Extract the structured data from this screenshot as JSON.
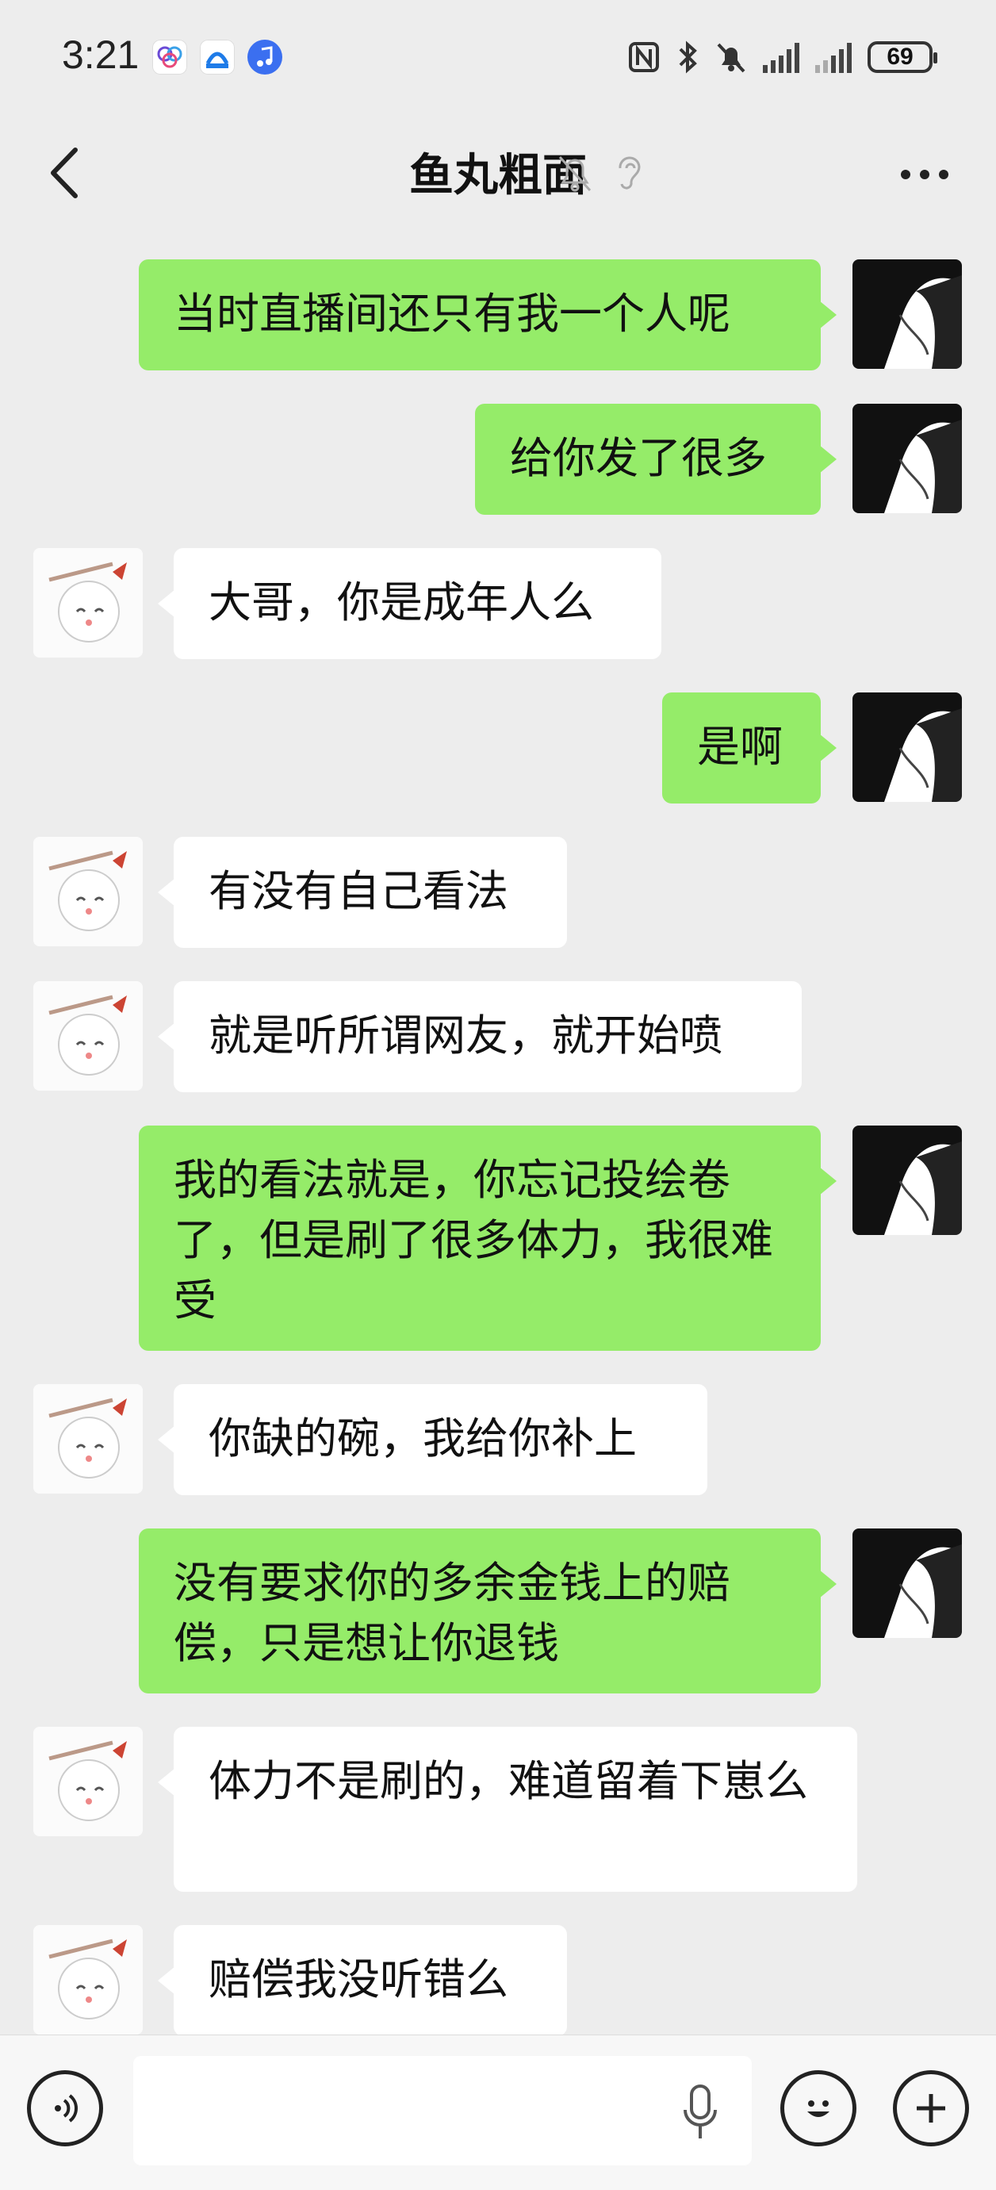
{
  "status_bar": {
    "time": "3:21",
    "battery": "69",
    "icons": [
      "nfc-icon",
      "bluetooth-icon",
      "mute-icon",
      "signal-icon",
      "signal-icon"
    ]
  },
  "header": {
    "title": "鱼丸粗面",
    "icons": [
      "chevron-left-icon",
      "bell-muted-icon",
      "ear-icon",
      "more-icon"
    ]
  },
  "colors": {
    "sent_bubble": "#95ec69",
    "received_bubble": "#ffffff",
    "background": "#ededed"
  },
  "messages": [
    {
      "side": "right",
      "text": "当时直播间还只有我一个人呢"
    },
    {
      "side": "right",
      "text": "给你发了很多"
    },
    {
      "side": "left",
      "text": "大哥，你是成年人么"
    },
    {
      "side": "right",
      "text": "是啊"
    },
    {
      "side": "left",
      "text": "有没有自己看法"
    },
    {
      "side": "left",
      "text": "就是听所谓网友，就开始喷"
    },
    {
      "side": "right",
      "text": "我的看法就是，你忘记投绘卷了，但是刷了很多体力，我很难受"
    },
    {
      "side": "left",
      "text": "你缺的碗，我给你补上"
    },
    {
      "side": "right",
      "text": "没有要求你的多余金钱上的赔偿，只是想让你退钱"
    },
    {
      "side": "left",
      "text": "体力不是刷的，难道留着下崽么"
    },
    {
      "side": "left",
      "text": "赔偿我没听错么"
    }
  ],
  "input_bar": {
    "placeholder": "",
    "icons": [
      "voice-icon",
      "microphone-icon",
      "emoji-icon",
      "plus-icon"
    ]
  }
}
